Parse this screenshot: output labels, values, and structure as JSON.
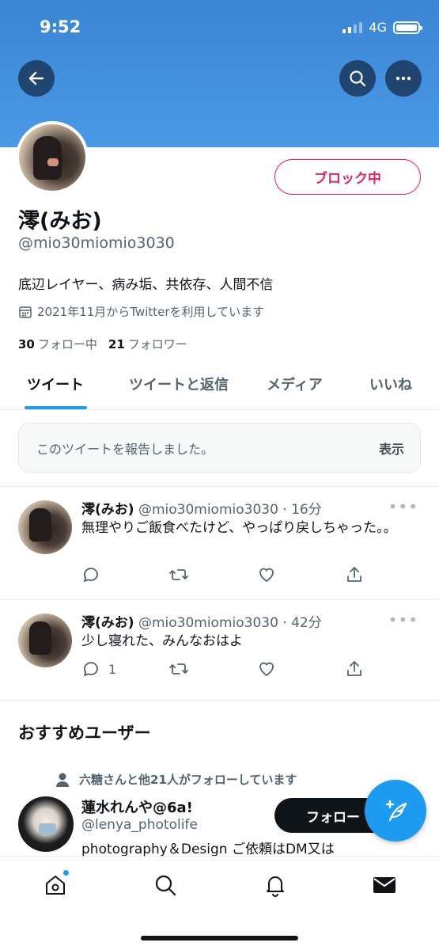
{
  "status_bar": {
    "time": "9:52",
    "network": "4G"
  },
  "profile": {
    "name": "澪(みお)",
    "handle": "@mio30miomio3030",
    "bio": "底辺レイヤー、病み垢、共依存、人間不信",
    "joined": "2021年11月からTwitterを利用しています",
    "following_count": "30",
    "following_label": "フォロー中",
    "followers_count": "21",
    "followers_label": "フォロワー",
    "block_label": "ブロック中"
  },
  "tabs": [
    "ツイート",
    "ツイートと返信",
    "メディア",
    "いいね"
  ],
  "notice": {
    "text": "このツイートを報告しました。",
    "action": "表示"
  },
  "tweets": [
    {
      "name": "澪(みお)",
      "meta": "@mio30miomio3030 · 16分",
      "body": "無理やりご飯食べたけど、やっぱり戻しちゃった。。",
      "reply_count": ""
    },
    {
      "name": "澪(みお)",
      "meta": "@mio30miomio3030 · 42分",
      "body": "少し寝れた、みんなおはよ",
      "reply_count": "1"
    }
  ],
  "suggestions": {
    "title": "おすすめユーザー",
    "social_context": "六糖さんと他21人がフォローしています",
    "user_name": "蓮水れんや@6a!",
    "user_handle": "@lenya_photolife",
    "user_bio": "photography＆Design ご依頼はDM又は",
    "follow_label": "フォロー"
  },
  "icons": {
    "back": "arrow-left-icon",
    "search": "search-icon",
    "more": "more-horizontal-icon",
    "calendar": "calendar-icon",
    "reply": "reply-icon",
    "retweet": "retweet-icon",
    "like": "heart-icon",
    "share": "share-icon",
    "compose": "compose-tweet-icon",
    "home": "home-icon",
    "explore": "search-icon",
    "notifications": "bell-icon",
    "messages": "mail-icon"
  },
  "colors": {
    "accent": "#1d9bf0",
    "block": "#e0245e",
    "banner": "#4a98e6"
  }
}
